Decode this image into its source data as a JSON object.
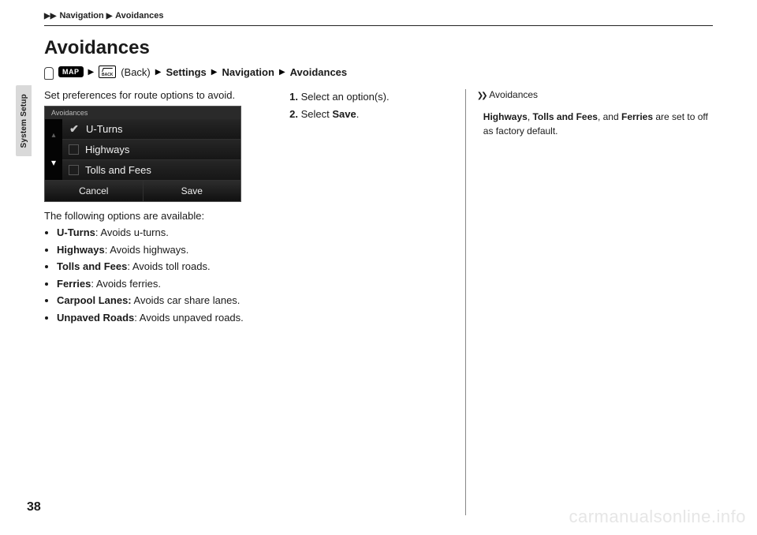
{
  "breadcrumb": {
    "part1": "Navigation",
    "part2": "Avoidances"
  },
  "side_tab": "System Setup",
  "title": "Avoidances",
  "path": {
    "back": "(Back)",
    "settings": "Settings",
    "navigation": "Navigation",
    "avoidances": "Avoidances",
    "map_label": "MAP"
  },
  "intro": "Set preferences for route options to avoid.",
  "screen": {
    "header": "Avoidances",
    "opt1": "U-Turns",
    "opt2": "Highways",
    "opt3": "Tolls and Fees",
    "cancel": "Cancel",
    "save": "Save"
  },
  "options_intro": "The following options are available:",
  "options": [
    {
      "name": "U-Turns",
      "desc": ": Avoids u-turns."
    },
    {
      "name": "Highways",
      "desc": ": Avoids highways."
    },
    {
      "name": "Tolls and Fees",
      "desc": ": Avoids toll roads."
    },
    {
      "name": "Ferries",
      "desc": ": Avoids ferries."
    },
    {
      "name": "Carpool Lanes:",
      "desc": " Avoids car share lanes."
    },
    {
      "name": "Unpaved Roads",
      "desc": ": Avoids unpaved roads."
    }
  ],
  "steps": {
    "s1a": "Select an option(s).",
    "s2a": "Select ",
    "s2b": "Save",
    "s2c": "."
  },
  "sidebar": {
    "head": "Avoidances",
    "b1": "Highways",
    "t1": ", ",
    "b2": "Tolls and Fees",
    "t2": ", and ",
    "b3": "Ferries",
    "t3": " are set to off as factory default."
  },
  "page_num": "38",
  "watermark": "carmanualsonline.info"
}
